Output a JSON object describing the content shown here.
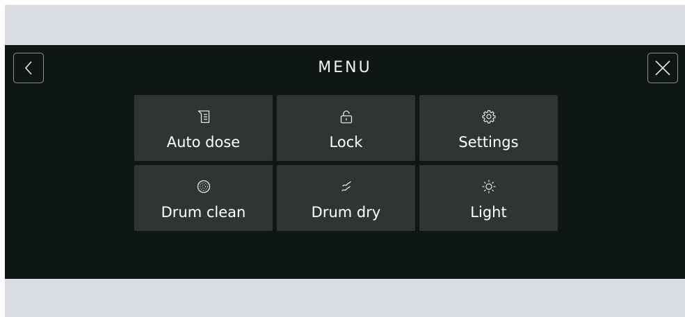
{
  "header": {
    "title": "MENU"
  },
  "menu": {
    "items": [
      {
        "label": "Auto dose",
        "icon": "dispenser-icon"
      },
      {
        "label": "Lock",
        "icon": "lock-icon"
      },
      {
        "label": "Settings",
        "icon": "gear-icon"
      },
      {
        "label": "Drum clean",
        "icon": "drum-icon"
      },
      {
        "label": "Drum dry",
        "icon": "air-flow-icon"
      },
      {
        "label": "Light",
        "icon": "sun-icon"
      }
    ]
  },
  "colors": {
    "screen_background": "#0f1716",
    "tile_background": "#303435",
    "bezel": "#d9dce1",
    "text": "#ffffff"
  }
}
